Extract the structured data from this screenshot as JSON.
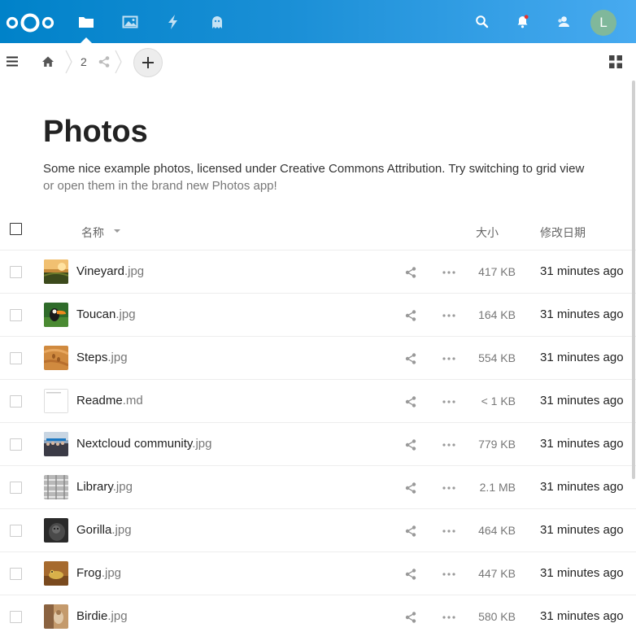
{
  "header": {
    "avatar_initial": "L",
    "brand_color": "#0082c9",
    "notification_dot_color": "#e9322d",
    "apps": [
      {
        "name": "files",
        "icon": "folder-icon",
        "active": true
      },
      {
        "name": "photos",
        "icon": "image-icon",
        "active": false
      },
      {
        "name": "activity",
        "icon": "lightning-icon",
        "active": false
      },
      {
        "name": "ghost",
        "icon": "ghost-icon",
        "active": false
      }
    ],
    "right_icons": [
      "search-icon",
      "bell-icon",
      "contacts-icon"
    ]
  },
  "breadcrumb": {
    "home_icon": "home-icon",
    "folder": "2",
    "share_icon": "share-icon"
  },
  "page": {
    "title": "Photos",
    "description": "Some nice example photos, licensed under Creative Commons Attribution. Try switching to grid view",
    "description_muted": "or open them in the brand new Photos app!"
  },
  "table": {
    "col_name": "名称",
    "col_size": "大小",
    "col_modified": "修改日期",
    "rows": [
      {
        "base": "Vineyard",
        "ext": ".jpg",
        "size": "417 KB",
        "modified": "31 minutes ago"
      },
      {
        "base": "Toucan",
        "ext": ".jpg",
        "size": "164 KB",
        "modified": "31 minutes ago"
      },
      {
        "base": "Steps",
        "ext": ".jpg",
        "size": "554 KB",
        "modified": "31 minutes ago"
      },
      {
        "base": "Readme",
        "ext": ".md",
        "size": "< 1 KB",
        "modified": "31 minutes ago"
      },
      {
        "base": "Nextcloud community",
        "ext": ".jpg",
        "size": "779 KB",
        "modified": "31 minutes ago"
      },
      {
        "base": "Library",
        "ext": ".jpg",
        "size": "2.1 MB",
        "modified": "31 minutes ago"
      },
      {
        "base": "Gorilla",
        "ext": ".jpg",
        "size": "464 KB",
        "modified": "31 minutes ago"
      },
      {
        "base": "Frog",
        "ext": ".jpg",
        "size": "447 KB",
        "modified": "31 minutes ago"
      },
      {
        "base": "Birdie",
        "ext": ".jpg",
        "size": "580 KB",
        "modified": "31 minutes ago"
      }
    ]
  }
}
